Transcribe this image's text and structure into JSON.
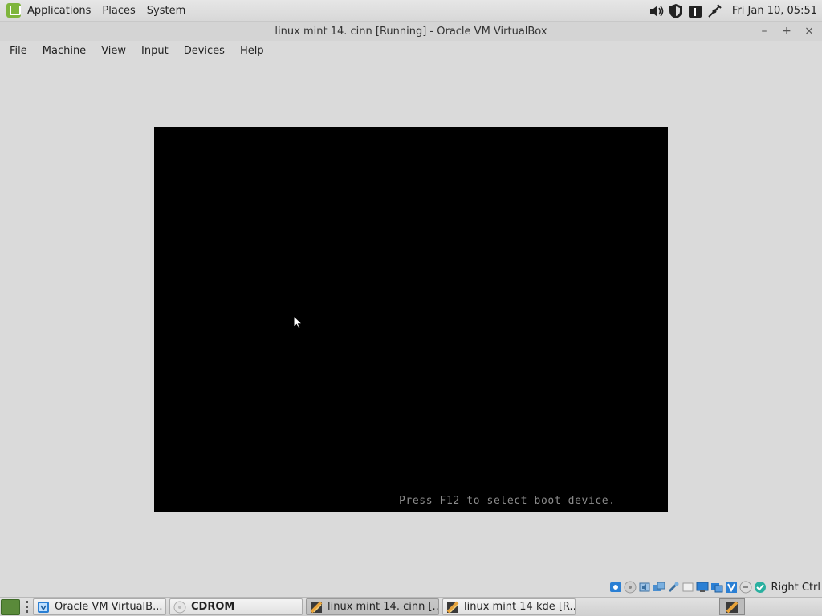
{
  "top_panel": {
    "menu": [
      "Applications",
      "Places",
      "System"
    ],
    "clock": "Fri Jan 10, 05:51"
  },
  "window": {
    "title": "linux mint 14. cinn [Running] - Oracle VM VirtualBox",
    "controls": [
      "–",
      "+",
      "×"
    ]
  },
  "menubar": [
    "File",
    "Machine",
    "View",
    "Input",
    "Devices",
    "Help"
  ],
  "vm": {
    "boot_message": "Press F12 to select boot device."
  },
  "statusbar": {
    "host_key": "Right Ctrl"
  },
  "taskbar": {
    "tasks": [
      {
        "label": "Oracle VM VirtualB...",
        "icon": "virtualbox-icon"
      },
      {
        "label": "CDROM",
        "icon": "cdrom-icon"
      },
      {
        "label": "linux mint 14. cinn [...",
        "icon": "vm-window-icon"
      },
      {
        "label": "linux mint 14 kde [R...",
        "icon": "vm-window-icon"
      }
    ]
  },
  "colors": {
    "mint_green": "#7fb53c",
    "vm_background": "#000000",
    "boot_text": "#8c8c8c"
  }
}
